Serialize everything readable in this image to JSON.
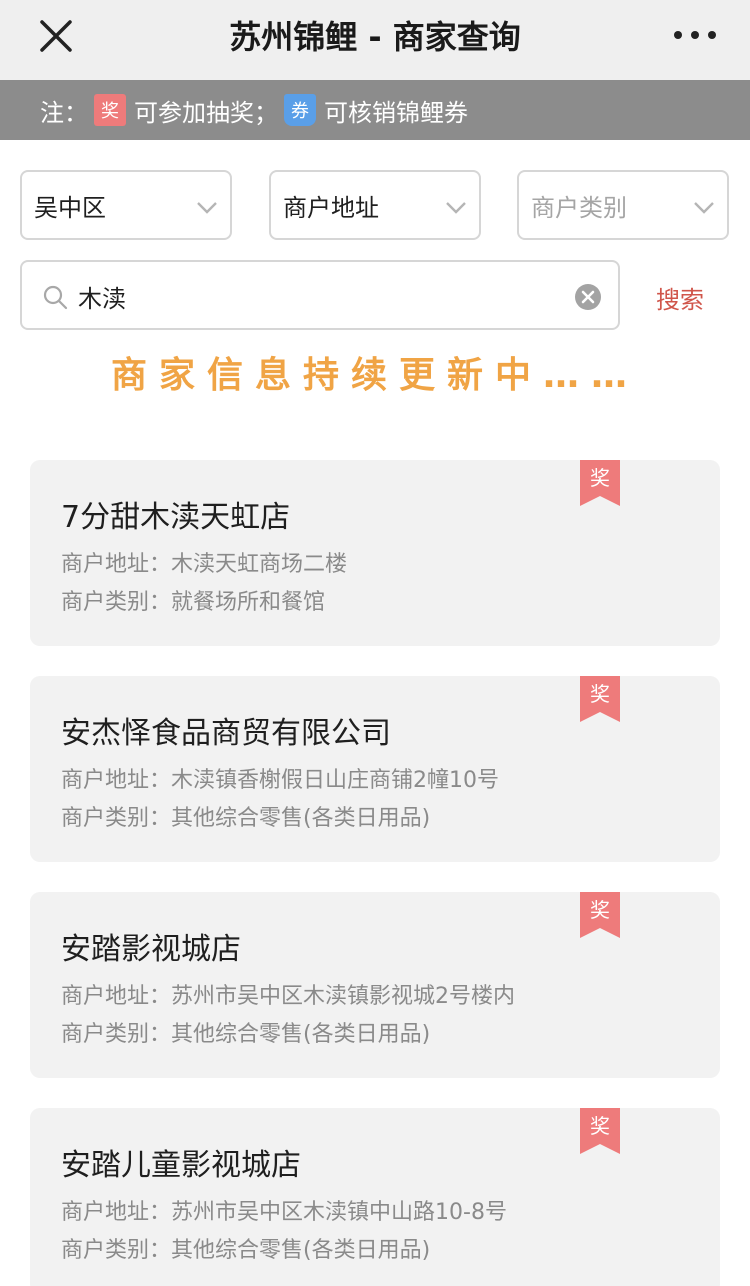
{
  "header": {
    "title": "苏州锦鲤 - 商家查询"
  },
  "note": {
    "prefix": "注：",
    "award_icon_char": "奖",
    "award_text": "可参加抽奖；",
    "coupon_icon_char": "券",
    "coupon_text": "可核销锦鲤券"
  },
  "filters": {
    "district": "吴中区",
    "address_type": "商户地址",
    "category_placeholder": "商户类别"
  },
  "search": {
    "value": "木渎",
    "button": "搜索"
  },
  "notice": "商家信息持续更新中……",
  "labels": {
    "address": "商户地址：",
    "category": "商户类别："
  },
  "merchants": [
    {
      "name": "7分甜木渎天虹店",
      "address": "木渎天虹商场二楼",
      "category": "就餐场所和餐馆",
      "tag": "奖"
    },
    {
      "name": "安杰怿食品商贸有限公司",
      "address": "木渎镇香榭假日山庄商铺2幢10号",
      "category": "其他综合零售(各类日用品)",
      "tag": "奖"
    },
    {
      "name": "安踏影视城店",
      "address": "苏州市吴中区木渎镇影视城2号楼内",
      "category": "其他综合零售(各类日用品)",
      "tag": "奖"
    },
    {
      "name": "安踏儿童影视城店",
      "address": "苏州市吴中区木渎镇中山路10-8号",
      "category": "其他综合零售(各类日用品)",
      "tag": "奖"
    }
  ],
  "colors": {
    "award": "#ee7b7b",
    "coupon": "#5a9fe8",
    "notice": "#f0a445",
    "search_link": "#d0554a"
  }
}
